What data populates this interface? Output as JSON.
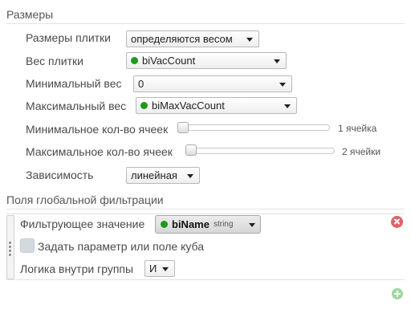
{
  "sizes": {
    "title": "Размеры",
    "tile_size_label": "Размеры плитки",
    "tile_size_value": "определяются весом",
    "tile_weight_label": "Вес плитки",
    "tile_weight_value": "biVacCount",
    "min_weight_label": "Минимальный вес",
    "min_weight_value": "0",
    "max_weight_label": "Максимальный вес",
    "max_weight_value": "biMaxVacCount",
    "min_cells_label": "Минимальное кол-во ячеек",
    "min_cells_value": "1 ячейка",
    "min_cells_level": 0,
    "max_cells_label": "Максимальное кол-во ячеек",
    "max_cells_value": "2 ячейки",
    "max_cells_level": 0,
    "dependency_label": "Зависимость",
    "dependency_value": "линейная"
  },
  "filters": {
    "title": "Поля глобальной фильтрации",
    "filter_value_label": "Фильтрующее значение",
    "filter_field_name": "biName",
    "filter_field_type": "string",
    "param_checkbox_label": "Задать параметр или поле куба",
    "group_logic_label": "Логика внутри группы",
    "group_logic_value": "И"
  },
  "colors": {
    "field_dot": "#1e9a1e",
    "remove": "#e0636a",
    "add": "#9fd6a0"
  },
  "icons": {
    "remove": "remove-icon",
    "add": "add-icon",
    "dropdown": "chevron-down-icon"
  }
}
